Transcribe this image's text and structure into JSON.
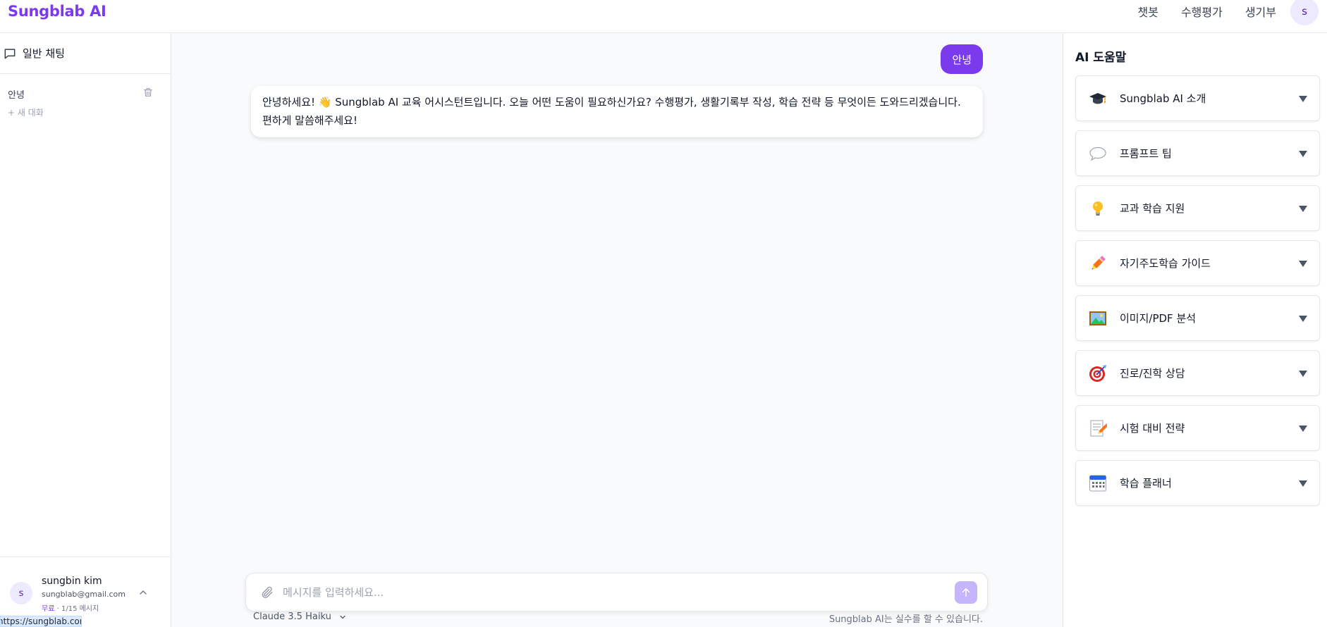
{
  "header": {
    "brand": "Sungblab AI",
    "nav": [
      "챗봇",
      "수행평가",
      "생기부"
    ],
    "avatar_initial": "s"
  },
  "sidebar": {
    "title": "일반 채팅",
    "conversations": [
      {
        "label": "안녕"
      }
    ],
    "new_chat_label": "+ 새 대화",
    "user": {
      "initial": "s",
      "name": "sungbin kim",
      "email": "sungblab@gmail.com",
      "plan": "무료",
      "separator": "·",
      "usage": "1/15 메시지"
    },
    "url_tooltip": "https://sungblab.com"
  },
  "chat": {
    "messages": [
      {
        "role": "user",
        "text": "안녕"
      },
      {
        "role": "assistant",
        "text": "안녕하세요! 👋 Sungblab AI 교육 어시스턴트입니다. 오늘 어떤 도움이 필요하신가요? 수행평가, 생활기록부 작성, 학습 전략 등 무엇이든 도와드리겠습니다. 편하게 말씀해주세요!"
      }
    ],
    "input_placeholder": "메시지를 입력하세요...",
    "model": "Claude 3.5 Haiku",
    "disclaimer": "Sungblab AI는 실수를 할 수 있습니다."
  },
  "help_panel": {
    "title": "AI 도움말",
    "items": [
      {
        "icon": "graduation-cap-icon",
        "label": "Sungblab AI 소개"
      },
      {
        "icon": "speech-bubble-icon",
        "label": "프롬프트 팁"
      },
      {
        "icon": "lightbulb-icon",
        "label": "교과 학습 지원"
      },
      {
        "icon": "pencil-icon",
        "label": "자기주도학습 가이드"
      },
      {
        "icon": "picture-icon",
        "label": "이미지/PDF 분석"
      },
      {
        "icon": "target-icon",
        "label": "진로/진학 상담"
      },
      {
        "icon": "memo-icon",
        "label": "시험 대비 전략"
      },
      {
        "icon": "calendar-icon",
        "label": "학습 플래너"
      }
    ]
  },
  "colors": {
    "accent": "#7c3aed",
    "accent_light": "#ede9fe",
    "send_disabled": "#c4b5fd"
  }
}
